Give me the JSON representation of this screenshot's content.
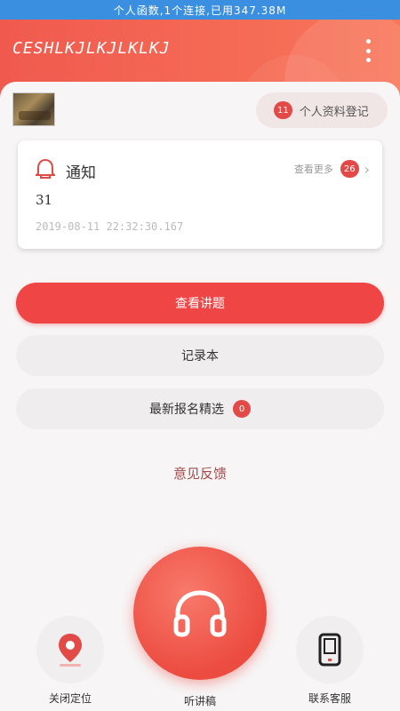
{
  "status_bar": {
    "text": "个人函数,1个连接,已用347.38M"
  },
  "header": {
    "title": "CESHLKJLKJLKLKJ"
  },
  "profile": {
    "badge": "11",
    "label": "个人资料登记"
  },
  "notice": {
    "title": "通知",
    "view_more_label": "查看更多",
    "count": "26",
    "body": "31",
    "timestamp": "2019-08-11 22:32:30.167"
  },
  "actions": {
    "primary_label": "查看讲题",
    "notepad_label": "记录本",
    "latest_label": "最新报名精选",
    "latest_badge": "0",
    "feedback_label": "意见反馈"
  },
  "bottom_nav": {
    "left_label": "关闭定位",
    "center_label": "听讲稿",
    "right_label": "联系客服"
  },
  "colors": {
    "accent": "#ef4545",
    "status_bar": "#3a8fe0"
  }
}
